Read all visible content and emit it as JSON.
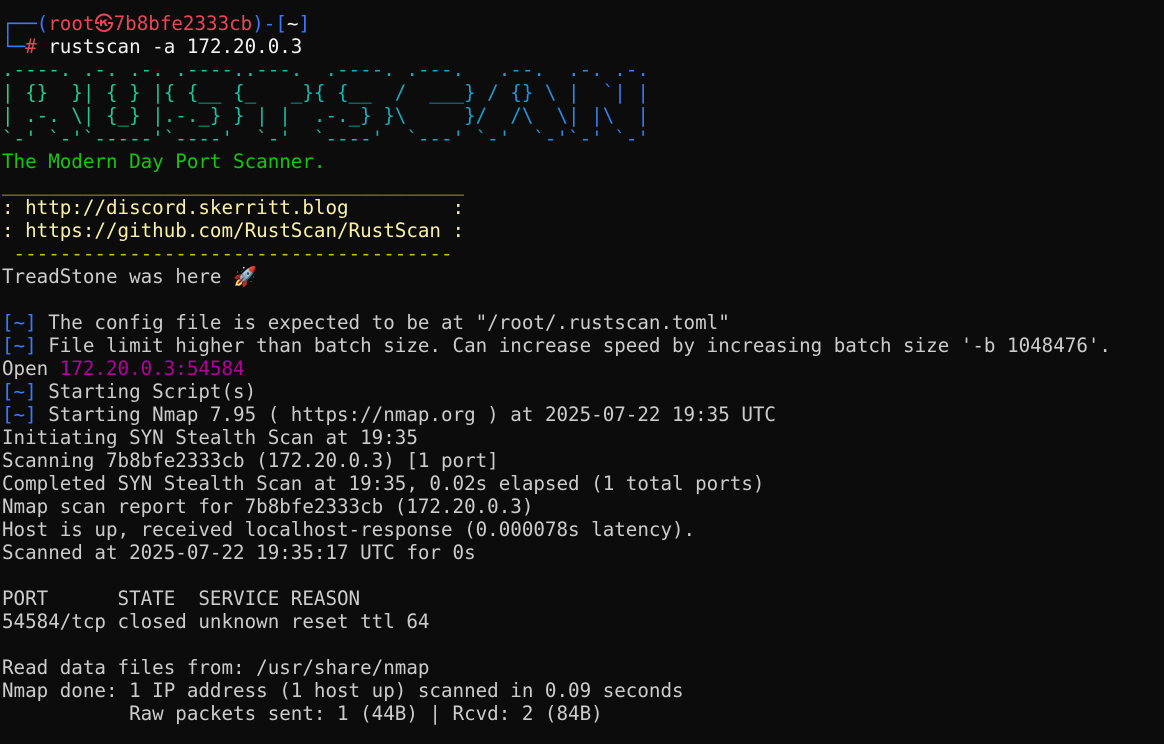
{
  "prompt": {
    "corner_top": "┌──(",
    "user": "root㉿7b8bfe2333cb",
    "mid": ")-[",
    "dir": "~",
    "end": "]",
    "corner_bottom": "└─",
    "hash": "# ",
    "command": "rustscan -a 172.20.0.3"
  },
  "banner": [
    ".----. .-. .-. .----..---.  .----. .---.   .--.  .-. .-.",
    "| {}  }| { } |{ {__ {_   _}{ {__  /  ___} / {} \\ |  `| |",
    "| .-. \\| {_} |.-._} } | |  .-._} }\\     }/  /\\  \\| |\\  |",
    "`-' `-'`-----'`----'  `-'  `----'  `---' `-'  `-'`-' `-'"
  ],
  "tagline": "The Modern Day Port Scanner.",
  "links": {
    "rule_top": "________________________________________",
    "discord": ": http://discord.skerritt.blog         :",
    "github": ": https://github.com/RustScan/RustScan :",
    "rule_bottom": " --------------------------------------"
  },
  "treadstone": "TreadStone was here 🚀",
  "log": {
    "tag": "[~]",
    "config": " The config file is expected to be at \"/root/.rustscan.toml\"",
    "file_limit": " File limit higher than batch size. Can increase speed by increasing batch size '-b 1048476'.",
    "open_label": "Open ",
    "open_addr": "172.20.0.3:54584",
    "starting_scripts": " Starting Script(s)",
    "starting_nmap": " Starting Nmap 7.95 ( https://nmap.org ) at 2025-07-22 19:35 UTC"
  },
  "nmap": [
    "Initiating SYN Stealth Scan at 19:35",
    "Scanning 7b8bfe2333cb (172.20.0.3) [1 port]",
    "Completed SYN Stealth Scan at 19:35, 0.02s elapsed (1 total ports)",
    "Nmap scan report for 7b8bfe2333cb (172.20.0.3)",
    "Host is up, received localhost-response (0.000078s latency).",
    "Scanned at 2025-07-22 19:35:17 UTC for 0s"
  ],
  "table": {
    "header": "PORT      STATE  SERVICE REASON",
    "row": "54584/tcp closed unknown reset ttl 64"
  },
  "footer": [
    "Read data files from: /usr/share/nmap",
    "Nmap done: 1 IP address (1 host up) scanned in 0.09 seconds",
    "           Raw packets sent: 1 (44B) | Rcvd: 2 (84B)"
  ]
}
